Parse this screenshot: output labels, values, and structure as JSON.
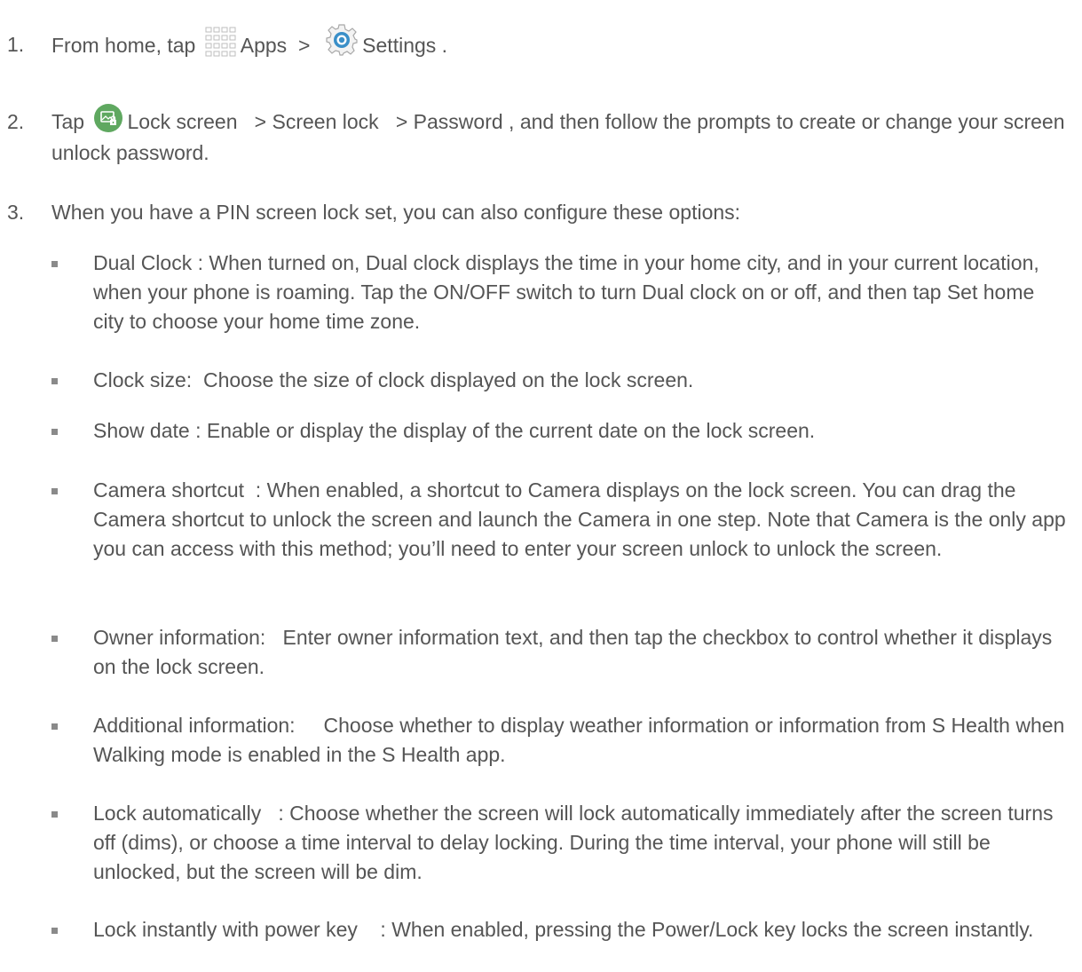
{
  "steps": [
    {
      "number": "1.",
      "pre": "From home, tap ",
      "apps_label": "Apps",
      "sep": "  >  ",
      "settings_label": "Settings",
      "post": " ."
    },
    {
      "number": "2.",
      "pre": "Tap ",
      "lock_screen_label": "Lock screen",
      "sep1": "   > ",
      "screen_lock_label": "Screen lock",
      "sep2": "   > ",
      "password_label": "Password",
      "post": " , and then follow the prompts to create or change your screen unlock password."
    },
    {
      "number": "3.",
      "text": "When you have a PIN screen lock set, you can also configure these options:"
    }
  ],
  "options": [
    {
      "term": "Dual Clock ",
      "desc": ": When turned on, Dual clock displays the time in your home city, and in your current location, when your phone is roaming. Tap the ON/OFF switch to turn Dual clock on or off, and then tap Set home city   to choose your home time zone."
    },
    {
      "term": "Clock size: ",
      "desc": " Choose the size of clock displayed on the lock screen."
    },
    {
      "term": "Show date ",
      "desc": ": Enable or display the display of the current date on the lock screen."
    },
    {
      "term": "Camera shortcut  ",
      "desc": ": When enabled, a shortcut to Camera displays on the lock screen. You can drag the Camera shortcut to unlock the screen and launch the Camera in one step. Note that Camera is the only app you can access with this method; you’ll need to enter your screen unlock to unlock the screen."
    },
    {
      "term": "Owner information:  ",
      "desc": "  Enter owner information text, and then tap the checkbox to control whether it displays on the lock screen."
    },
    {
      "term": "Additional information:    ",
      "desc": "  Choose whether to display weather information or information from S Health when Walking mode is enabled in the S Health app."
    },
    {
      "term": "Lock automatically   ",
      "desc": ": Choose whether the screen will lock automatically immediately after the screen turns off (dims), or choose a time interval to delay locking. During the time interval, your phone will still be unlocked, but the screen will be dim."
    },
    {
      "term": "Lock instantly with power key    ",
      "desc": ": When enabled, pressing the Power/Lock key locks the screen instantly."
    }
  ],
  "icons": {
    "apps": "apps-grid-icon",
    "settings": "settings-gear-icon",
    "lock_screen": "lock-screen-icon"
  },
  "colors": {
    "text": "#555555",
    "icon_green": "#5fa860",
    "gear_blue": "#3a8fc8",
    "bullet": "#8a8a8a"
  }
}
